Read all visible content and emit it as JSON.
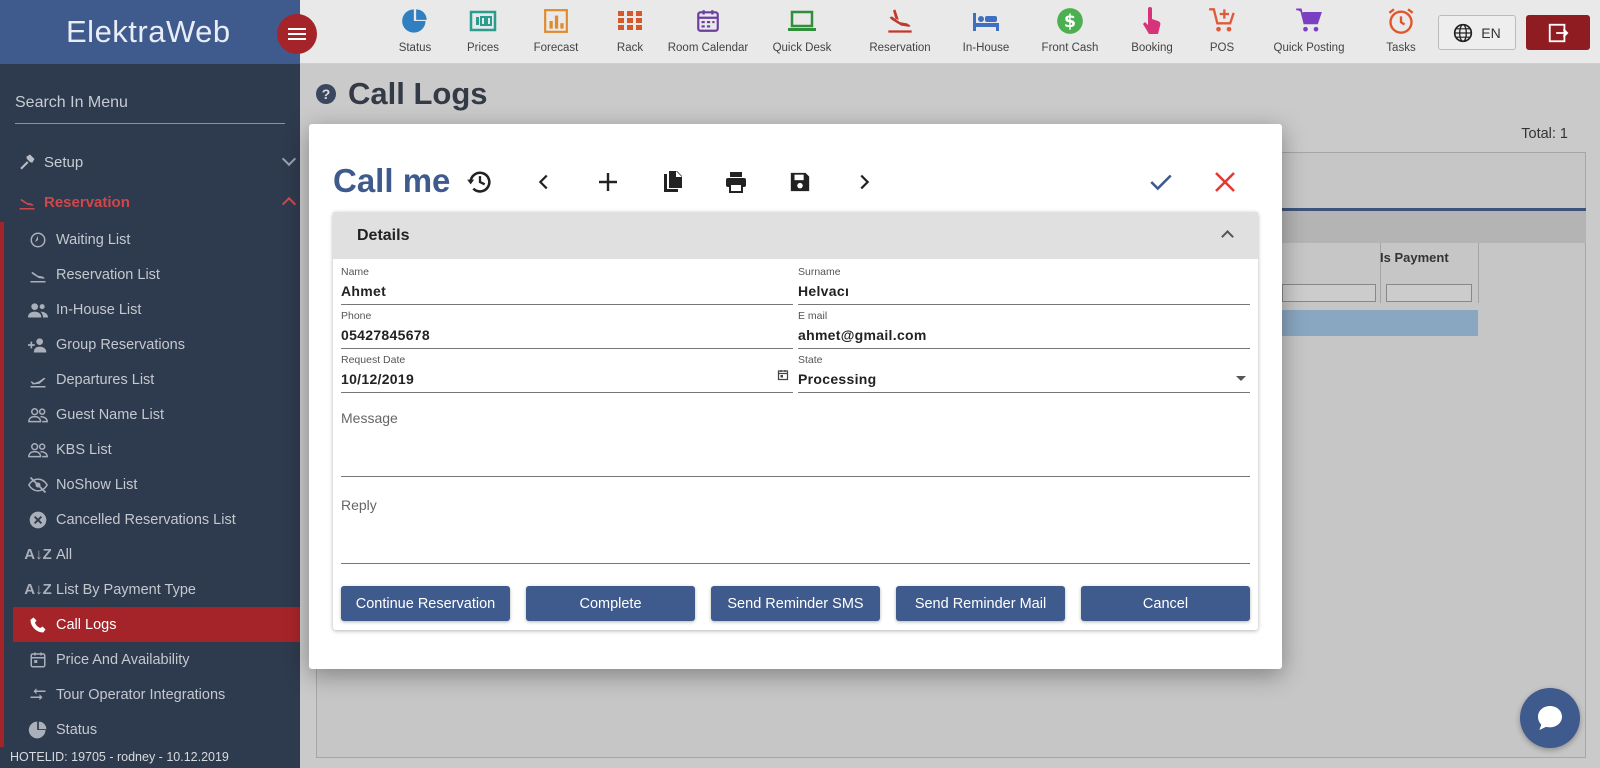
{
  "app": {
    "brand": "ElektraWeb"
  },
  "sidebar": {
    "search_placeholder": "Search In Menu",
    "sections": [
      {
        "label": "Setup",
        "icon": "hammer-icon",
        "open": false
      },
      {
        "label": "Reservation",
        "icon": "plane-landing-icon",
        "open": true
      }
    ],
    "items": [
      {
        "label": "Waiting List",
        "icon": "clock-icon"
      },
      {
        "label": "Reservation List",
        "icon": "plane-landing-icon"
      },
      {
        "label": "In-House List",
        "icon": "people-icon"
      },
      {
        "label": "Group Reservations",
        "icon": "group-add-icon"
      },
      {
        "label": "Departures List",
        "icon": "plane-takeoff-icon"
      },
      {
        "label": "Guest Name List",
        "icon": "people-outline-icon"
      },
      {
        "label": "KBS List",
        "icon": "people-outline-icon"
      },
      {
        "label": "NoShow List",
        "icon": "eye-off-icon"
      },
      {
        "label": "Cancelled Reservations List",
        "icon": "cancel-circle-icon"
      },
      {
        "label": "All",
        "icon": "sort-az-icon"
      },
      {
        "label": "List By Payment Type",
        "icon": "sort-az-icon"
      },
      {
        "label": "Call Logs",
        "icon": "phone-icon",
        "active": true
      },
      {
        "label": "Price And Availability",
        "icon": "calendar-icon"
      },
      {
        "label": "Tour Operator Integrations",
        "icon": "swap-icon"
      },
      {
        "label": "Status",
        "icon": "pie-chart-icon"
      }
    ],
    "footer": "HOTELID: 19705 - rodney - 10.12.2019"
  },
  "toolbar": {
    "items": [
      {
        "label": "Status",
        "icon": "pie-chart-icon",
        "color": "#2f7fc1"
      },
      {
        "label": "Prices",
        "icon": "price-tag-icon",
        "color": "#2a9d8f"
      },
      {
        "label": "Forecast",
        "icon": "bar-chart-icon",
        "color": "#e08a2c"
      },
      {
        "label": "Rack",
        "icon": "grid-icon",
        "color": "#d45a2a"
      },
      {
        "label": "Room Calendar",
        "icon": "calendar-icon",
        "color": "#6a3fa0"
      },
      {
        "label": "Quick Desk",
        "icon": "laptop-icon",
        "color": "#2f8f3a"
      },
      {
        "label": "Reservation",
        "icon": "plane-landing-icon",
        "color": "#c0392b"
      },
      {
        "label": "In-House",
        "icon": "bed-icon",
        "color": "#3f6fc1"
      },
      {
        "label": "Front Cash",
        "icon": "dollar-icon",
        "color": "#4caf50"
      },
      {
        "label": "Booking",
        "icon": "touch-icon",
        "color": "#d6337a"
      },
      {
        "label": "POS",
        "icon": "cart-add-icon",
        "color": "#e05a3a"
      },
      {
        "label": "Quick Posting",
        "icon": "cart-icon",
        "color": "#7b3fc1"
      },
      {
        "label": "Tasks",
        "icon": "alarm-icon",
        "color": "#e0552a"
      }
    ],
    "language": "EN"
  },
  "page": {
    "title": "Call Logs",
    "total": "Total: 1",
    "grid_column": "Is Payment"
  },
  "dialog": {
    "title": "Call me",
    "section_title": "Details",
    "fields": {
      "name": {
        "label": "Name",
        "value": "Ahmet"
      },
      "surname": {
        "label": "Surname",
        "value": "Helvacı"
      },
      "phone": {
        "label": "Phone",
        "value": "05427845678"
      },
      "email": {
        "label": "E mail",
        "value": "ahmet@gmail.com"
      },
      "request_date": {
        "label": "Request Date",
        "value": "10/12/2019"
      },
      "state": {
        "label": "State",
        "value": "Processing"
      },
      "message": {
        "placeholder": "Message"
      },
      "reply": {
        "placeholder": "Reply"
      }
    },
    "buttons": {
      "continue": "Continue Reservation",
      "complete": "Complete",
      "sms": "Send Reminder SMS",
      "mail": "Send Reminder Mail",
      "cancel": "Cancel"
    },
    "colors": {
      "accent": "#3f5a8c",
      "close": "#e53935",
      "primary_red": "#a5242a"
    }
  }
}
